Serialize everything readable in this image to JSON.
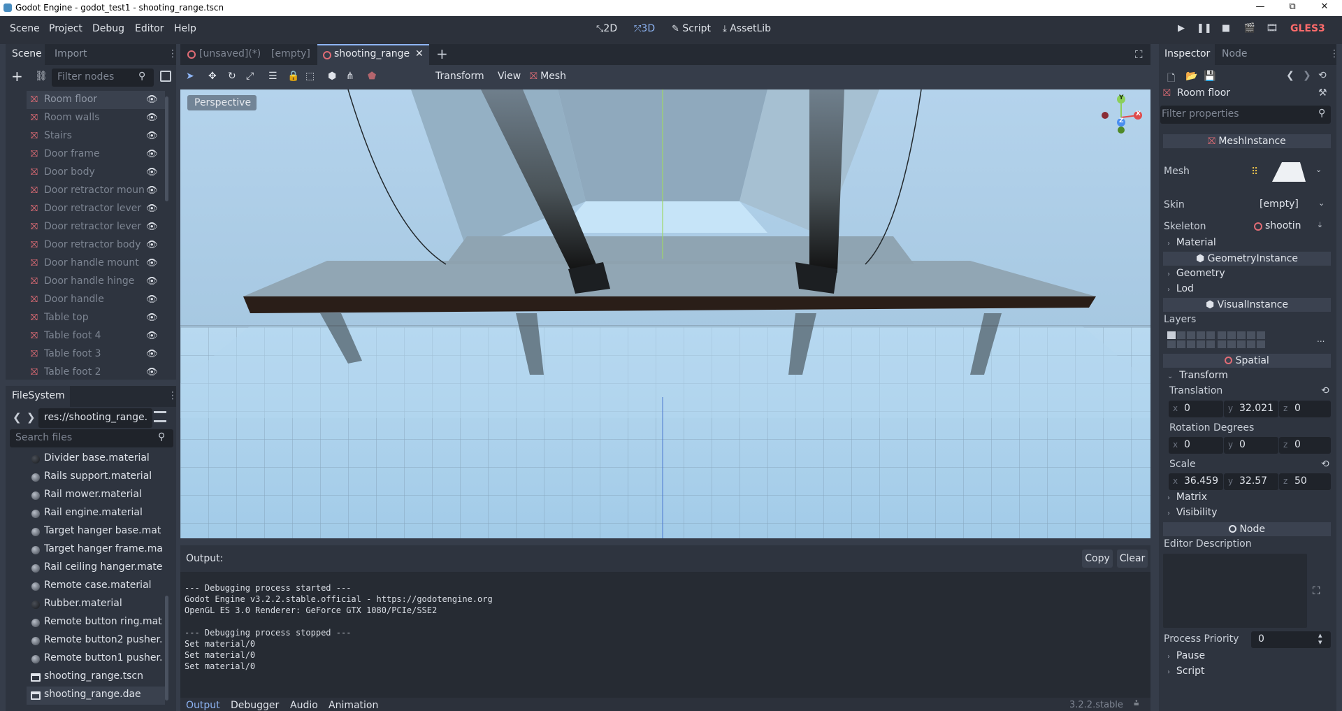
{
  "window": {
    "title": "Godot Engine - godot_test1 - shooting_range.tscn",
    "minimize": "—",
    "maximize": "⧉",
    "close": "✕"
  },
  "menubar": {
    "items": [
      "Scene",
      "Project",
      "Debug",
      "Editor",
      "Help"
    ],
    "modes": [
      {
        "label": "2D",
        "icon": "2d-icon"
      },
      {
        "label": "3D",
        "icon": "3d-icon",
        "active": true
      },
      {
        "label": "Script",
        "icon": "script-icon"
      },
      {
        "label": "AssetLib",
        "icon": "assetlib-icon"
      }
    ],
    "renderer": "GLES3",
    "accent": "#8eb5f5",
    "renderer_color": "#ff6b6b"
  },
  "scene_dock": {
    "tabs": [
      "Scene",
      "Import"
    ],
    "filter_placeholder": "Filter nodes",
    "nodes": [
      "Room floor",
      "Room walls",
      "Stairs",
      "Door frame",
      "Door body",
      "Door retractor moun",
      "Door retractor lever",
      "Door retractor lever",
      "Door retractor body",
      "Door handle mount",
      "Door handle hinge",
      "Door handle",
      "Table top",
      "Table foot 4",
      "Table foot 3",
      "Table foot 2"
    ],
    "selected_index": 0
  },
  "filesystem_dock": {
    "title": "FileSystem",
    "path": "res://shooting_range.",
    "search_placeholder": "Search files",
    "files": [
      {
        "name": "Divider base.material",
        "type": "material-dark"
      },
      {
        "name": "Rails support.material",
        "type": "material"
      },
      {
        "name": "Rail mower.material",
        "type": "material"
      },
      {
        "name": "Rail engine.material",
        "type": "material"
      },
      {
        "name": "Target hanger base.mat",
        "type": "material"
      },
      {
        "name": "Target hanger frame.ma",
        "type": "material"
      },
      {
        "name": "Rail ceiling hanger.mate",
        "type": "material"
      },
      {
        "name": "Remote case.material",
        "type": "material"
      },
      {
        "name": "Rubber.material",
        "type": "material-dark"
      },
      {
        "name": "Remote button ring.mat",
        "type": "material"
      },
      {
        "name": "Remote button2 pusher.",
        "type": "material"
      },
      {
        "name": "Remote button1 pusher.",
        "type": "material"
      },
      {
        "name": "shooting_range.tscn",
        "type": "scene"
      },
      {
        "name": "shooting_range.dae",
        "type": "scene",
        "selected": true
      }
    ]
  },
  "scene_tabs": [
    {
      "label": "[unsaved](*)",
      "active": false
    },
    {
      "label": "[empty]",
      "active": false
    },
    {
      "label": "shooting_range",
      "active": true
    }
  ],
  "viewport_toolbar": {
    "menus": [
      "Transform",
      "View",
      "Mesh"
    ]
  },
  "viewport": {
    "perspective_label": "Perspective",
    "gizmo": {
      "x": "X",
      "y": "Y",
      "z": "Z"
    }
  },
  "output": {
    "title": "Output:",
    "copy": "Copy",
    "clear": "Clear",
    "lines": [
      "",
      "--- Debugging process started ---",
      "Godot Engine v3.2.2.stable.official - https://godotengine.org",
      "OpenGL ES 3.0 Renderer: GeForce GTX 1080/PCIe/SSE2",
      "",
      "--- Debugging process stopped ---",
      "Set material/0",
      "Set material/0",
      "Set material/0"
    ],
    "bottom_tabs": [
      "Output",
      "Debugger",
      "Audio",
      "Animation"
    ],
    "version": "3.2.2.stable"
  },
  "inspector": {
    "tabs": [
      "Inspector",
      "Node"
    ],
    "object_name": "Room floor",
    "filter_placeholder": "Filter properties",
    "class_meshinstance": "MeshInstance",
    "mesh_label": "Mesh",
    "skin_label": "Skin",
    "skin_value": "[empty]",
    "skeleton_label": "Skeleton",
    "skeleton_value": "shootin",
    "material_label": "Material",
    "class_geometry": "GeometryInstance",
    "geometry_label": "Geometry",
    "lod_label": "Lod",
    "class_visual": "VisualInstance",
    "layers_label": "Layers",
    "layers_more": "...",
    "class_spatial": "Spatial",
    "transform_label": "Transform",
    "translation_label": "Translation",
    "translation": {
      "x": "0",
      "y": "32.021",
      "z": "0"
    },
    "rotation_label": "Rotation Degrees",
    "rotation": {
      "x": "0",
      "y": "0",
      "z": "0"
    },
    "scale_label": "Scale",
    "scale": {
      "x": "36.459",
      "y": "32.57",
      "z": "50"
    },
    "matrix_label": "Matrix",
    "visibility_label": "Visibility",
    "class_node": "Node",
    "editor_description_label": "Editor Description",
    "process_priority_label": "Process Priority",
    "process_priority_value": "0",
    "pause_label": "Pause",
    "script_label": "Script"
  }
}
